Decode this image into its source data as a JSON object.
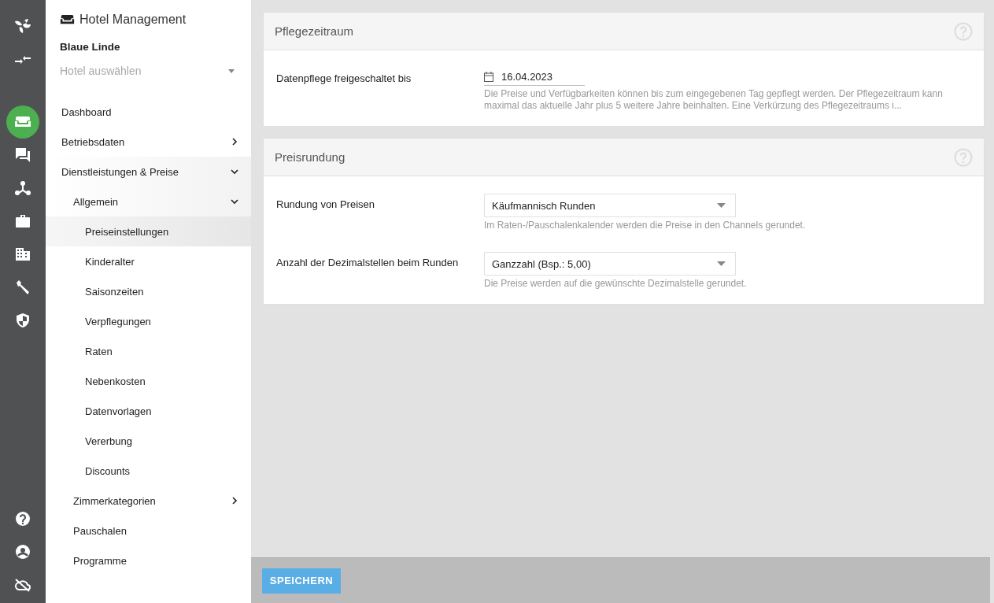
{
  "rail": {
    "top": [
      {
        "kind": "leaf",
        "selected": false
      },
      {
        "kind": "arrows",
        "selected": false
      },
      {
        "kind": "sofa",
        "selected": true
      },
      {
        "kind": "chat",
        "selected": false
      },
      {
        "kind": "network",
        "selected": false
      },
      {
        "kind": "briefcase",
        "selected": false
      },
      {
        "kind": "building",
        "selected": false
      },
      {
        "kind": "wrench",
        "selected": false
      },
      {
        "kind": "shield",
        "selected": false
      }
    ],
    "bottom": [
      {
        "kind": "help",
        "selected": false
      },
      {
        "kind": "user",
        "selected": false
      },
      {
        "kind": "cloud-off",
        "selected": false
      }
    ]
  },
  "sidebar": {
    "title": "Hotel Management",
    "hotel": "Blaue Linde",
    "hotel_select": {
      "placeholder": "Hotel auswählen"
    },
    "items": [
      {
        "label": "Dashboard",
        "selected": false
      },
      {
        "label": "Betriebsdaten",
        "selected": false,
        "expanded": false
      },
      {
        "label": "Dienstleistungen & Preise",
        "selected": false,
        "expanded": true,
        "children": [
          {
            "label": "Allgemein",
            "selected": false,
            "expanded": true,
            "children": [
              {
                "label": "Preiseinstellungen",
                "selected": true
              },
              {
                "label": "Kinderalter",
                "selected": false
              },
              {
                "label": "Saisonzeiten",
                "selected": false
              },
              {
                "label": "Verpflegungen",
                "selected": false
              },
              {
                "label": "Raten",
                "selected": false
              },
              {
                "label": "Nebenkosten",
                "selected": false
              },
              {
                "label": "Datenvorlagen",
                "selected": false
              },
              {
                "label": "Vererbung",
                "selected": false
              },
              {
                "label": "Discounts",
                "selected": false
              }
            ]
          },
          {
            "label": "Zimmerkategorien",
            "selected": false,
            "expanded": false
          },
          {
            "label": "Pauschalen",
            "selected": false
          },
          {
            "label": "Programme",
            "selected": false
          }
        ]
      }
    ]
  },
  "cards": [
    {
      "title": "Pflegezeitraum",
      "fields": [
        {
          "kind": "date",
          "label": "Datenpflege freigeschaltet bis",
          "value": "16.04.2023",
          "hint": "Die Preise und Verfügbarkeiten können bis zum eingegebenen Tag gepflegt werden. Der Pflegezeitraum kann maximal das aktuelle Jahr plus 5 weitere Jahre beinhalten. Eine Verkürzung des Pflegezeitraums i..."
        }
      ]
    },
    {
      "title": "Preisrundung",
      "fields": [
        {
          "kind": "select",
          "label": "Rundung von Preisen",
          "value": "Käufmannisch Runden",
          "hint": "Im Raten-/Pauschalenkalender werden die Preise in den Channels gerundet."
        },
        {
          "kind": "select",
          "label": "Anzahl der Dezimalstellen beim Runden",
          "value": "Ganzzahl (Bsp.: 5,00)",
          "hint": "Die Preise werden auf die gewünschte Dezimalstelle gerundet."
        }
      ]
    }
  ],
  "save_button": "SPEICHERN"
}
